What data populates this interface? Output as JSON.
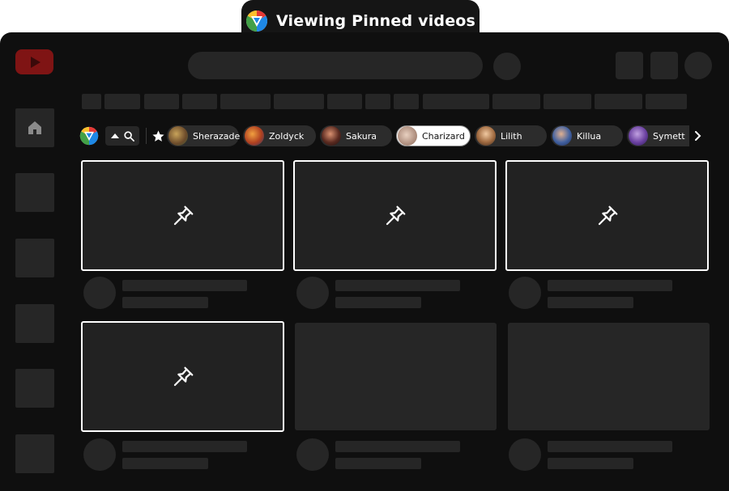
{
  "header": {
    "title": "Viewing Pinned videos",
    "logo_icon": "extension-logo-icon"
  },
  "toolbar": {
    "sort_icon": "caret-up-icon",
    "search_icon": "search-icon",
    "favorites_icon": "star-icon",
    "next_icon": "chevron-right-icon"
  },
  "chips": [
    {
      "label": "Sherazade",
      "selected": false
    },
    {
      "label": "Zoldyck",
      "selected": false
    },
    {
      "label": "Sakura",
      "selected": false
    },
    {
      "label": "Charizard",
      "selected": true
    },
    {
      "label": "Lilith",
      "selected": false
    },
    {
      "label": "Killua",
      "selected": false
    },
    {
      "label": "Symett",
      "selected": false
    }
  ],
  "pinned_icon": "pushpin-icon",
  "colors": {
    "background": "#0f0f0f",
    "skeleton": "#262626",
    "card_border": "#ffffff",
    "youtube_red_dim": "#7f1414"
  }
}
